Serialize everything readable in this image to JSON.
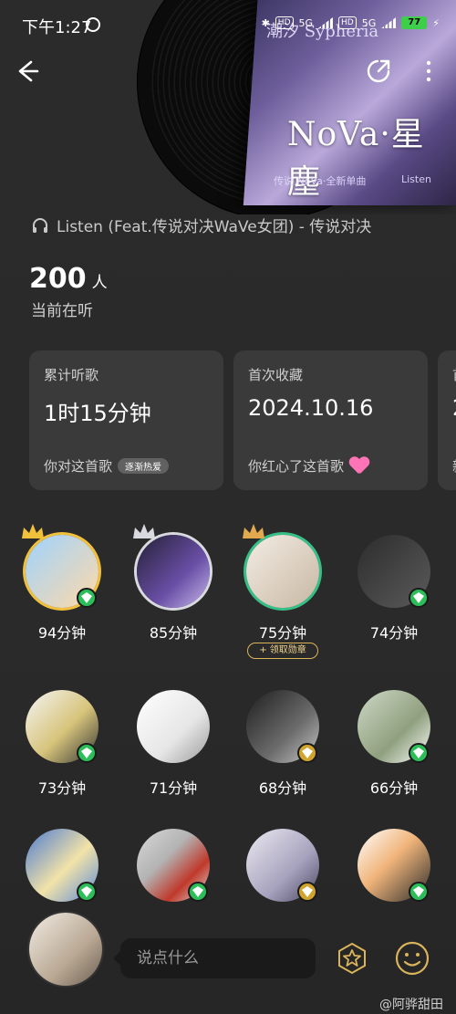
{
  "status_bar": {
    "time": "下午1:27",
    "chips": [
      "HD",
      "5G",
      "HD",
      "5G"
    ],
    "battery": "77"
  },
  "album": {
    "logo_text": "潮汐 Sypheria",
    "title": "NoVa·星塵",
    "subtitle": "传说 NoVa·全新单曲",
    "subtitle2": "Listen"
  },
  "song": {
    "title": "Listen (Feat.传说对决WaVe女团) - 传说对决"
  },
  "listeners": {
    "count": "200",
    "unit": "人",
    "label": "当前在听"
  },
  "stats": [
    {
      "label": "累计听歌",
      "value": "1时15分钟",
      "foot": "你对这首歌",
      "chip": "逐渐热爱"
    },
    {
      "label": "首次收藏",
      "value": "2024.10.16",
      "foot": "你红心了这首歌"
    },
    {
      "label": "首",
      "value": "2",
      "foot": "新"
    }
  ],
  "top_listeners": [
    {
      "minutes": "94分钟",
      "crown": "gold",
      "badge": "green"
    },
    {
      "minutes": "85分钟",
      "crown": "silver",
      "badge": ""
    },
    {
      "minutes": "75分钟",
      "crown": "bronze",
      "badge": "",
      "chip": "+ 领取勋章"
    },
    {
      "minutes": "74分钟",
      "crown": "",
      "badge": "green"
    },
    {
      "minutes": "73分钟",
      "crown": "",
      "badge": "green"
    },
    {
      "minutes": "71分钟",
      "crown": "",
      "badge": ""
    },
    {
      "minutes": "68分钟",
      "crown": "",
      "badge": "gold"
    },
    {
      "minutes": "66分钟",
      "crown": "",
      "badge": "green"
    },
    {
      "minutes": "",
      "crown": "",
      "badge": "green"
    },
    {
      "minutes": "",
      "crown": "",
      "badge": "green"
    },
    {
      "minutes": "",
      "crown": "",
      "badge": "gold"
    },
    {
      "minutes": "",
      "crown": "",
      "badge": "green"
    }
  ],
  "composer": {
    "placeholder": "说点什么"
  },
  "watermark": "@阿骅甜田",
  "colors": {
    "background": "#2a2a2b",
    "card": "#3a3a3b",
    "vip_green": "#2dbe5a",
    "vip_gold": "#d1a430",
    "crown_gold": "#f2c13b",
    "heart_pink": "#ff74b7"
  },
  "icons": {
    "back": "back-arrow-icon",
    "share": "share-icon",
    "more": "more-vertical-icon",
    "headphones": "headphones-icon",
    "heart": "heart-icon",
    "star": "star-badge-icon",
    "smile": "smile-icon"
  }
}
